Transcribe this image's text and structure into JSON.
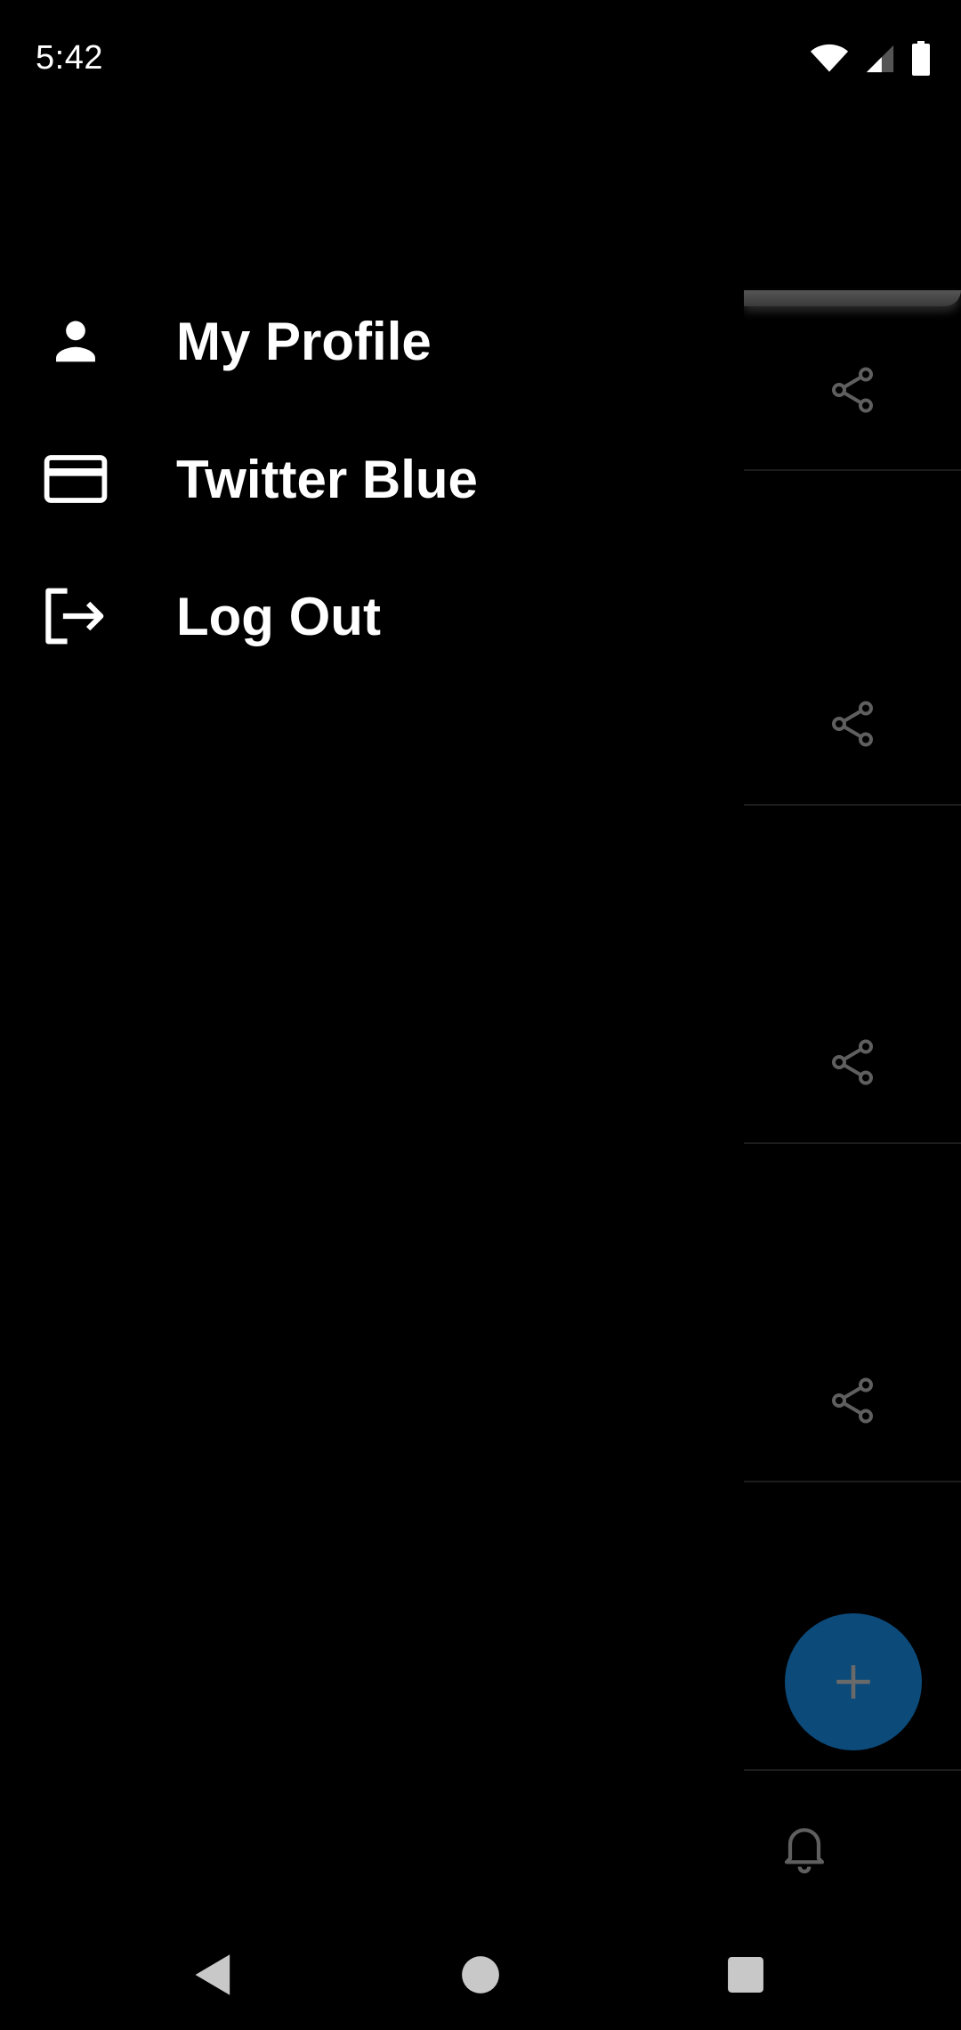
{
  "status_bar": {
    "time": "5:42",
    "icons": [
      "wifi-icon",
      "cell-signal-icon",
      "battery-icon"
    ]
  },
  "drawer": {
    "items": [
      {
        "label": "My Profile",
        "icon": "person-icon"
      },
      {
        "label": "Twitter Blue",
        "icon": "credit-card-icon"
      },
      {
        "label": "Log Out",
        "icon": "logout-icon"
      }
    ]
  },
  "background": {
    "share_icons": [
      "share-icon",
      "share-icon",
      "share-icon",
      "share-icon"
    ],
    "fab_icon": "plus-icon",
    "bottom_nav_icon": "bell-icon"
  },
  "nav_bar": {
    "buttons": [
      "back-icon",
      "home-icon",
      "recents-icon"
    ]
  },
  "colors": {
    "background": "#000000",
    "text": "#ffffff",
    "fab": "#0c4a7a",
    "dim_icon": "#5f5f5f"
  }
}
